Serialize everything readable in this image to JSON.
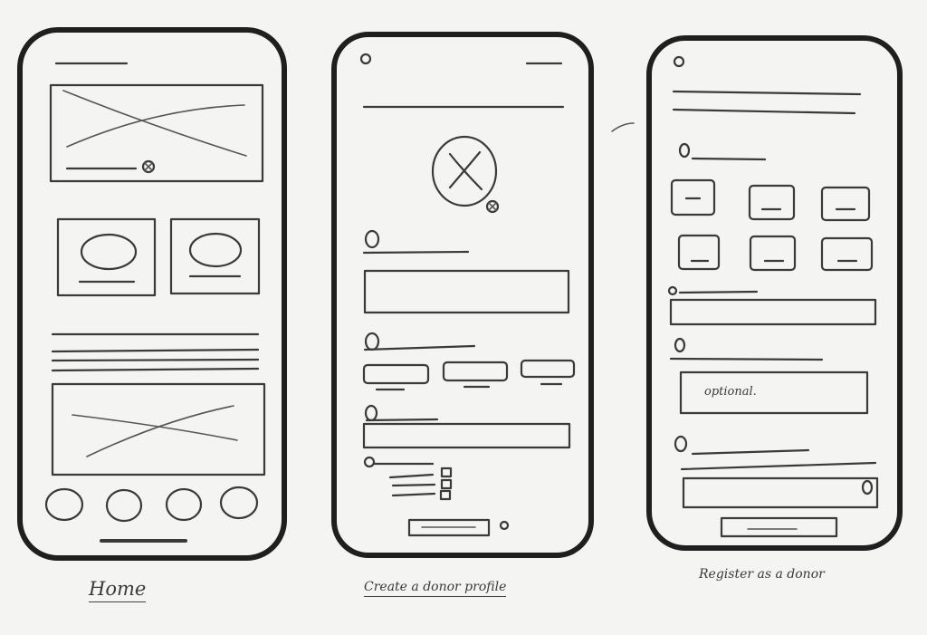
{
  "captions": {
    "home": "Home",
    "create_donor": "Create a donor profile",
    "register_donor": "Register as a donor"
  },
  "register": {
    "field_hint": "optional."
  },
  "colors": {
    "paper": "#f4f4f2",
    "ink": "#1f1f1f",
    "pencil": "#3a3a3a"
  }
}
